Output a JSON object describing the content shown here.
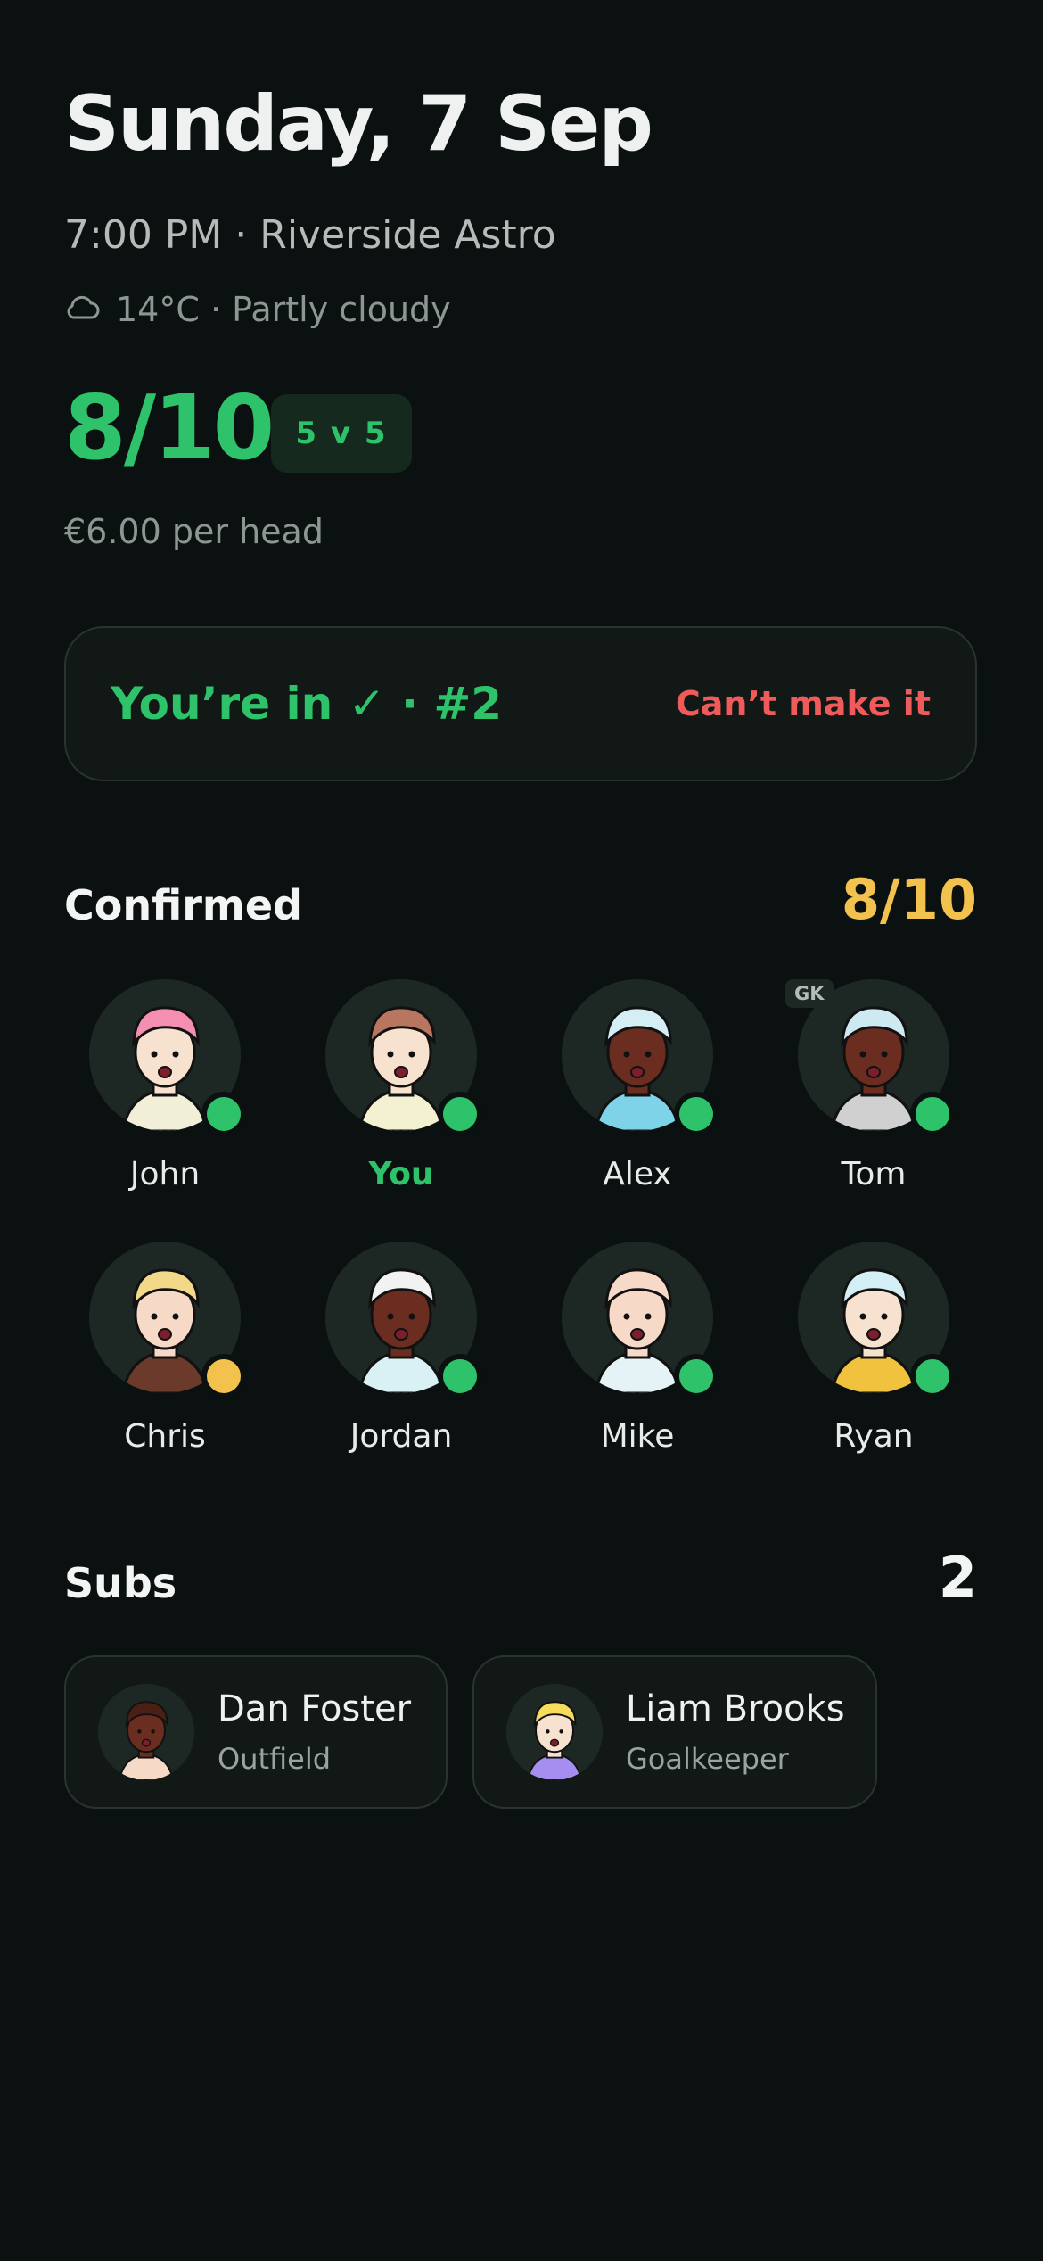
{
  "header": {
    "date_title": "Sunday, 7 Sep",
    "time_location": "7:00 PM · Riverside Astro",
    "weather_icon": "cloud-icon",
    "weather": "14°C · Partly cloudy"
  },
  "match": {
    "count": "8/10",
    "format": "5 v 5",
    "price": "€6.00 per head"
  },
  "status": {
    "in_label": "You’re in ✓ · #2",
    "cant_label": "Can’t make it"
  },
  "confirmed": {
    "title": "Confirmed",
    "count": "8/10",
    "players": [
      {
        "name": "John",
        "status": "green",
        "hair": "#f48fb1",
        "skin": "#f7e2cf",
        "shirt": "#f2efd8"
      },
      {
        "name": "You",
        "status": "green",
        "hair": "#b87660",
        "skin": "#f7e2cf",
        "shirt": "#f4f0d2"
      },
      {
        "name": "Alex",
        "status": "green",
        "hair": "#d4eef5",
        "skin": "#6b2d1f",
        "shirt": "#7fd3e8"
      },
      {
        "name": "Tom",
        "status": "green",
        "hair": "#cfe9f2",
        "skin": "#6b2d1f",
        "shirt": "#d0d0d0",
        "badge": "GK"
      },
      {
        "name": "Chris",
        "status": "yellow",
        "hair": "#f2d98a",
        "skin": "#f7d9c8",
        "shirt": "#6b3a2a"
      },
      {
        "name": "Jordan",
        "status": "green",
        "hair": "#f2f2f2",
        "skin": "#6b2d1f",
        "shirt": "#d9f0f5"
      },
      {
        "name": "Mike",
        "status": "green",
        "hair": "#f7d9c8",
        "skin": "#f7d9c8",
        "shirt": "#e6f3f6"
      },
      {
        "name": "Ryan",
        "status": "green",
        "hair": "#d4eef5",
        "skin": "#f7e2cf",
        "shirt": "#f0c23e"
      }
    ]
  },
  "subs": {
    "title": "Subs",
    "count": "2",
    "items": [
      {
        "name": "Dan Foster",
        "role": "Outfield",
        "hair": "#4a1f14",
        "skin": "#6b2d1f",
        "shirt": "#f7d9c8"
      },
      {
        "name": "Liam Brooks",
        "role": "Goalkeeper",
        "hair": "#f6dc5a",
        "skin": "#f7e2cf",
        "shirt": "#a58ef0"
      }
    ]
  },
  "colors": {
    "accent_green": "#2ec36a",
    "accent_yellow": "#f2c14e",
    "danger_red": "#ef5b5b",
    "background": "#0b1110"
  }
}
